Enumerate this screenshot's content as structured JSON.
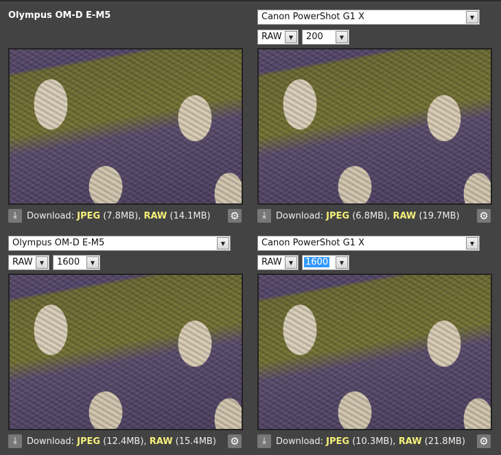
{
  "panels": [
    {
      "camera": "Olympus OM-D E-M5",
      "camera_is_title": true,
      "download": {
        "label": "Download:",
        "jpeg": "JPEG",
        "jpeg_size": "(7.8MB),",
        "raw": "RAW",
        "raw_size": "(14.1MB)"
      }
    },
    {
      "camera": "Canon PowerShot G1 X",
      "format": "RAW",
      "iso": "200",
      "download": {
        "label": "Download:",
        "jpeg": "JPEG",
        "jpeg_size": "(6.8MB),",
        "raw": "RAW",
        "raw_size": "(19.7MB)"
      }
    },
    {
      "camera": "Olympus OM-D E-M5",
      "format": "RAW",
      "iso": "1600",
      "download": {
        "label": "Download:",
        "jpeg": "JPEG",
        "jpeg_size": "(12.4MB),",
        "raw": "RAW",
        "raw_size": "(15.4MB)"
      }
    },
    {
      "camera": "Canon PowerShot G1 X",
      "format": "RAW",
      "iso": "1600",
      "download": {
        "label": "Download:",
        "jpeg": "JPEG",
        "jpeg_size": "(10.3MB),",
        "raw": "RAW",
        "raw_size": "(21.8MB)"
      }
    }
  ],
  "icons": {
    "download": "download-icon",
    "settings": "gear-icon",
    "dropdown": "chevron-down-icon"
  }
}
